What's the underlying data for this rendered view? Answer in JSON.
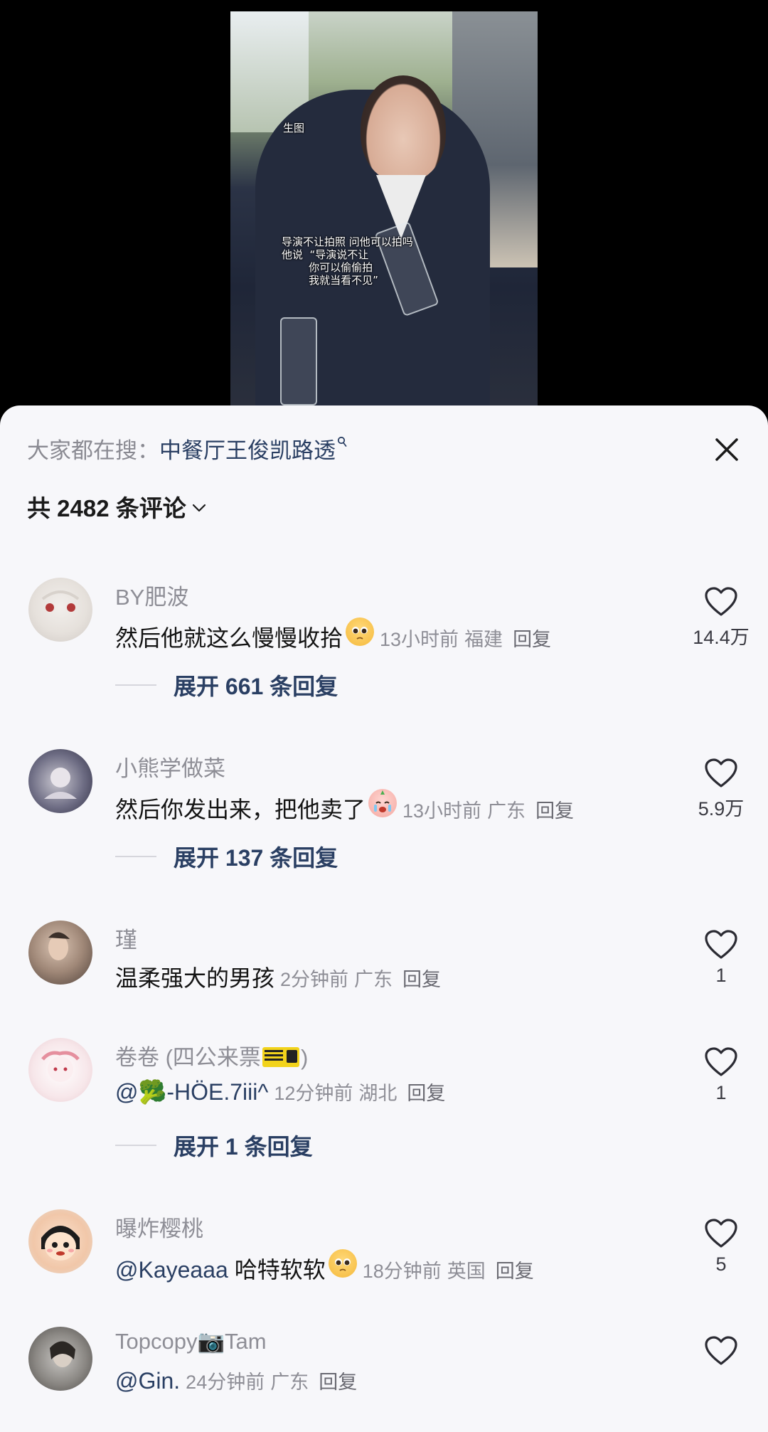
{
  "video": {
    "label_raw": "生图",
    "caption_lines": [
      "导演不让拍照 问他可以拍吗",
      "他说  “导演说不让",
      "        你可以偷偷拍",
      "        我就当看不见”"
    ]
  },
  "search_bar": {
    "prefix": "大家都在搜：",
    "keyword": "中餐厅王俊凯路透"
  },
  "comments_header": {
    "count_label": "共 2482 条评论"
  },
  "comments": [
    {
      "username": "BY肥波",
      "text": "然后他就这么慢慢收拾",
      "emoji": "pleading-face",
      "time": "13小时前",
      "location": "福建",
      "reply_label": "回复",
      "likes": "14.4万",
      "expand_label": "展开 661 条回复"
    },
    {
      "username": "小熊学做菜",
      "text": "然后你发出来，把他卖了",
      "emoji": "crying-face",
      "time": "13小时前",
      "location": "广东",
      "reply_label": "回复",
      "likes": "5.9万",
      "expand_label": "展开 137 条回复"
    },
    {
      "username": "瑾",
      "text": "温柔强大的男孩",
      "time": "2分钟前",
      "location": "广东",
      "reply_label": "回复",
      "likes": "1"
    },
    {
      "username": "卷卷 (四公来票",
      "username_suffix": ")",
      "text": "@🥦-HÖE.7iii^",
      "time": "12分钟前",
      "location": "湖北",
      "reply_label": "回复",
      "likes": "1",
      "expand_label": "展开 1 条回复"
    },
    {
      "username": "曝炸樱桃",
      "mention": "@Kayeaaa",
      "text": " 哈特软软",
      "emoji": "pleading-face",
      "time": "18分钟前",
      "location": "英国",
      "reply_label": "回复",
      "likes": "5"
    },
    {
      "username": "Topcopy📷Tam",
      "text": "@Gin.",
      "time": "24分钟前",
      "location": "广东",
      "reply_label": "回复",
      "likes": ""
    }
  ],
  "colors": {
    "sheet_bg": "#f7f7fa",
    "link_blue": "#2a3f63",
    "meta_gray": "#8e8e96"
  }
}
